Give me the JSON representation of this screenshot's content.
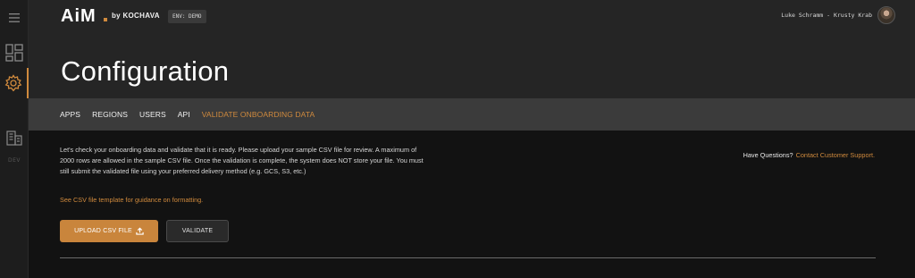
{
  "brand": {
    "logo_text": "AiM",
    "by_text": "by KOCHAVA",
    "accent": "#d08a3d"
  },
  "env_badge": "ENV: DEMO",
  "user": {
    "label": "Luke Schramm - Krusty Krab"
  },
  "sidebar": {
    "items": [
      {
        "icon": "hamburger-menu-icon"
      },
      {
        "icon": "dashboard-icon"
      },
      {
        "icon": "gear-icon",
        "active": true
      },
      {
        "icon": "building-icon"
      }
    ],
    "dev_label": "DEV"
  },
  "page_title": "Configuration",
  "tabs": [
    {
      "label": "APPS"
    },
    {
      "label": "REGIONS"
    },
    {
      "label": "USERS"
    },
    {
      "label": "API"
    },
    {
      "label": "VALIDATE ONBOARDING DATA",
      "active": true
    }
  ],
  "content": {
    "intro": "Let's check your onboarding data and validate that it is ready. Please upload your sample CSV file for review. A maximum of 2000 rows are allowed in the sample CSV file. Once the validation is complete, the system does NOT store your file. You must still submit the validated file using your preferred delivery method (e.g. GCS, S3, etc.)",
    "template_link": "See CSV file template for guidance on formatting.",
    "help_question": "Have Questions?",
    "help_link": "Contact Customer Support.",
    "upload_label": "UPLOAD CSV FILE",
    "validate_label": "VALIDATE"
  }
}
